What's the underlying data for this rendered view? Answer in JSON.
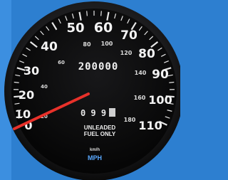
{
  "speedometer": {
    "mph_labels": [
      "0",
      "10",
      "20",
      "30",
      "40",
      "50",
      "60",
      "70",
      "80",
      "90",
      "100",
      "110"
    ],
    "kmh_labels": [
      "20",
      "40",
      "60",
      "80",
      "100",
      "120",
      "140",
      "160",
      "180"
    ],
    "odometer": "200000",
    "trip_meter": "0 9 9",
    "fuel_line_1": "UNLEADED",
    "fuel_line_2": "FUEL ONLY",
    "kmh_unit": "km/h",
    "mph_unit": "MPH",
    "needle_reading_mph": 0,
    "colors": {
      "background": "#2d7fd0",
      "dial": "#0b0b0c",
      "needle": "#e8312a",
      "unit_blue": "#5aa9ff"
    }
  }
}
